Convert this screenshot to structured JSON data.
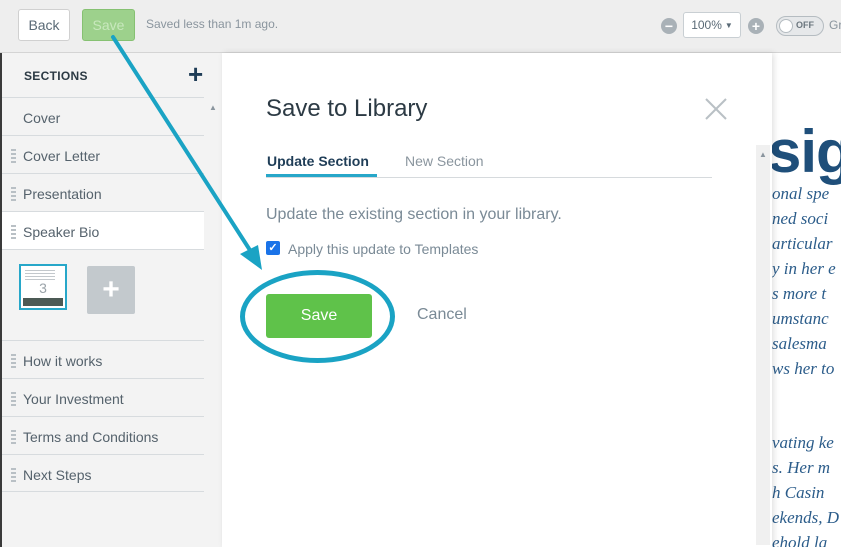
{
  "toolbar": {
    "back_label": "Back",
    "save_label": "Save",
    "saved_status": "Saved less than 1m ago.",
    "zoom_minus": "−",
    "zoom_value": "100%",
    "zoom_plus": "+",
    "toggle_label": "OFF",
    "trailing_text": "Gr"
  },
  "sidebar": {
    "header": "SECTIONS",
    "add_symbol": "+",
    "items": [
      {
        "label": "Cover"
      },
      {
        "label": "Cover Letter"
      },
      {
        "label": "Presentation"
      },
      {
        "label": "Speaker Bio"
      },
      {
        "label": "How it works"
      },
      {
        "label": "Your Investment"
      },
      {
        "label": "Terms and Conditions"
      },
      {
        "label": "Next Steps"
      }
    ],
    "thumbnail_page_number": "3",
    "thumbnail_add": "+"
  },
  "modal": {
    "title": "Save to Library",
    "tabs": [
      {
        "label": "Update Section",
        "active": true
      },
      {
        "label": "New Section",
        "active": false
      }
    ],
    "description": "Update the existing section in your library.",
    "checkbox_label": "Apply this update to Templates",
    "checkbox_checked": true,
    "save_label": "Save",
    "cancel_label": "Cancel"
  },
  "canvas": {
    "title_fragment": "sig",
    "text_lines": [
      "onal spe",
      "ned soci",
      "articular",
      "y in her e",
      "s more t",
      "umstanc",
      "salesma",
      "ws her to",
      "vating ke",
      "s. Her m",
      "h Casin",
      "ekends, D",
      "ehold la"
    ]
  },
  "colors": {
    "accent": "#27a7c9",
    "save_green": "#5fc24a",
    "annotation_arrow": "#1aa3c4",
    "heading_blue": "#1f4f7a"
  }
}
